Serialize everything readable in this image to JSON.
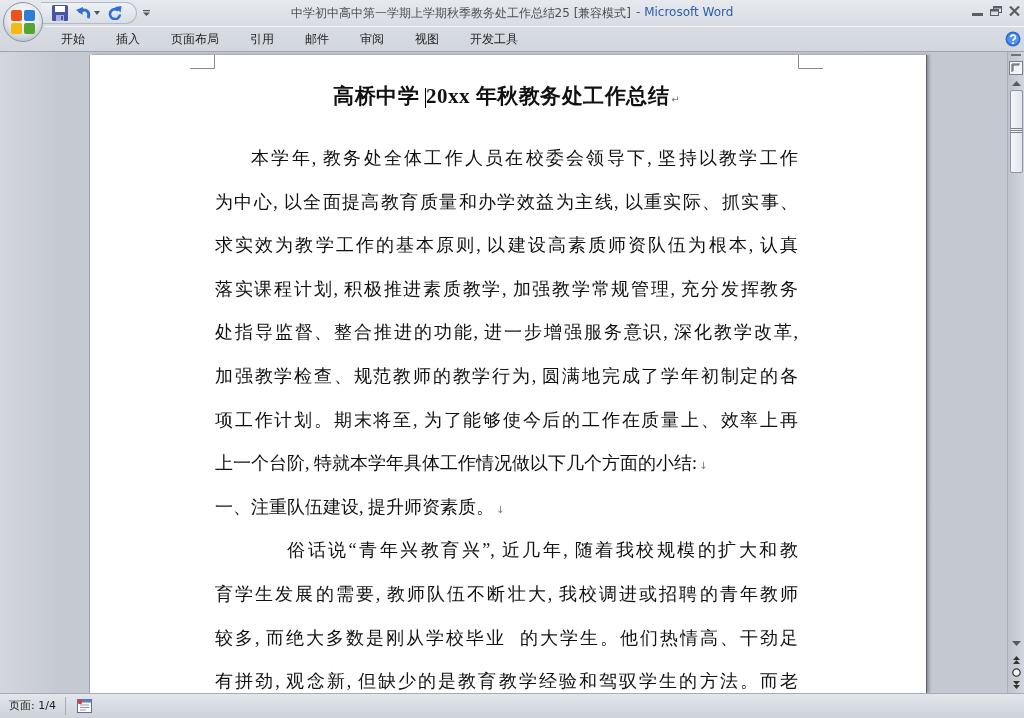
{
  "window": {
    "document_title": "中学初中高中第一学期上学期秋季教务处工作总结25 [兼容模式]",
    "app_title": "- Microsoft Word"
  },
  "ribbon_tabs": [
    {
      "label": "开始",
      "selected": false
    },
    {
      "label": "插入",
      "selected": false
    },
    {
      "label": "页面布局",
      "selected": false
    },
    {
      "label": "引用",
      "selected": false
    },
    {
      "label": "邮件",
      "selected": false
    },
    {
      "label": "审阅",
      "selected": false
    },
    {
      "label": "视图",
      "selected": false
    },
    {
      "label": "开发工具",
      "selected": false
    }
  ],
  "document": {
    "title": {
      "before_caret": "高桥中学 ",
      "after_caret": "20xx 年秋教务处工作总结",
      "mark": "↵"
    },
    "paragraphs": [
      {
        "kind": "indented",
        "lines": [
          "本学年, 教务处全体工作人员在校委会领导下, 坚持以教学工作",
          "为中心, 以全面提高教育质量和办学效益为主线, 以重实际、抓实事、",
          "求实效为教学工作的基本原则, 以建设高素质师资队伍为根本, 认真",
          "落实课程计划, 积极推进素质教学, 加强教学常规管理, 充分发挥教务",
          "处指导监督、整合推进的功能, 进一步增强服务意识, 深化教学改革,",
          "加强教学检查、规范教师的教学行为, 圆满地完成了学年初制定的各",
          "项工作计划。期末将至, 为了能够使今后的工作在质量上、效率上再",
          "上一个台阶, 特就本学年具体工作情况做以下几个方面的小结:"
        ],
        "mark": "↓"
      },
      {
        "kind": "flush",
        "lines": [
          "一、注重队伍建设, 提升师资素质。"
        ],
        "mark": "↓"
      },
      {
        "kind": "deep",
        "lines": [
          "俗话说“青年兴教育兴”, 近几年, 随着我校规模的扩大和教",
          "育学生发展的需要, 教师队伍不断壮大, 我校调进或招聘的青年教师",
          "较多, 而绝大多数是刚从学校毕业  的大学生。他们热情高、干劲足",
          "有拼劲, 观念新, 但缺少的是教育教学经验和驾驭学生的方法。而老"
        ]
      }
    ]
  },
  "status_bar": {
    "page": "页面: 1/4"
  }
}
